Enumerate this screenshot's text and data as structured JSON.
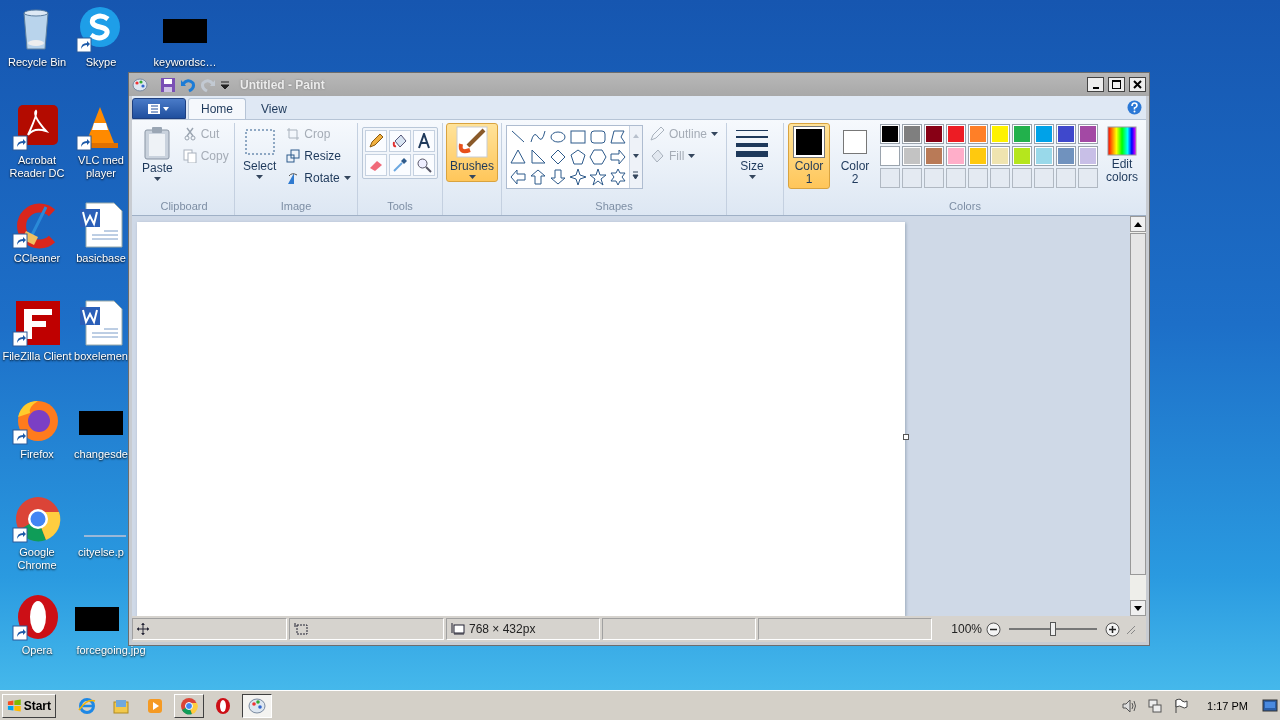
{
  "desktop": {
    "columns": [
      [
        {
          "label": "Recycle Bin",
          "shortcut": false
        },
        {
          "label": "Acrobat\nReader DC",
          "shortcut": true
        },
        {
          "label": "CCleaner",
          "shortcut": true
        },
        {
          "label": "FileZilla Client",
          "shortcut": true
        },
        {
          "label": "Firefox",
          "shortcut": true
        },
        {
          "label": "Google\nChrome",
          "shortcut": true
        },
        {
          "label": "Opera",
          "shortcut": true
        }
      ],
      [
        {
          "label": "Skype",
          "shortcut": true
        },
        {
          "label": "VLC med\nplayer",
          "shortcut": true
        },
        {
          "label": "basicbase",
          "shortcut": false
        },
        {
          "label": "boxelemen",
          "shortcut": false
        },
        {
          "label": "changesde",
          "shortcut": false
        },
        {
          "label": "cityelse.p",
          "shortcut": false
        },
        {
          "label": "forcegoing.jpg",
          "shortcut": false
        }
      ],
      [
        {
          "label": "keywordsc…",
          "shortcut": false
        }
      ]
    ]
  },
  "paint": {
    "title": "Untitled - Paint",
    "tabs": [
      {
        "label": "Home",
        "selected": true
      },
      {
        "label": "View",
        "selected": false
      }
    ],
    "ribbon": {
      "clipboard": {
        "label": "Clipboard",
        "paste": "Paste",
        "cut": {
          "label": "Cut",
          "disabled": true
        },
        "copy": {
          "label": "Copy",
          "disabled": true
        }
      },
      "image": {
        "label": "Image",
        "select": "Select",
        "crop": {
          "label": "Crop",
          "disabled": true
        },
        "resize": {
          "label": "Resize",
          "disabled": false
        },
        "rotate": {
          "label": "Rotate",
          "disabled": false
        }
      },
      "tools": {
        "label": "Tools"
      },
      "brushes": {
        "label": "Brushes",
        "selected": true
      },
      "shapes": {
        "label": "Shapes",
        "outline": {
          "label": "Outline",
          "disabled": true
        },
        "fill": {
          "label": "Fill",
          "disabled": true
        }
      },
      "size": {
        "label": "Size"
      },
      "colors": {
        "label": "Colors",
        "color1": {
          "label": "Color\n1",
          "color": "#000000",
          "selected": true
        },
        "color2": {
          "label": "Color\n2",
          "color": "#ffffff",
          "selected": false
        },
        "palette": [
          {
            "color": "#000000"
          },
          {
            "color": "#7f7f7f"
          },
          {
            "color": "#880015"
          },
          {
            "color": "#ed1c24"
          },
          {
            "color": "#ff7f27"
          },
          {
            "color": "#fff200"
          },
          {
            "color": "#22b14c"
          },
          {
            "color": "#00a2e8"
          },
          {
            "color": "#3f48cc"
          },
          {
            "color": "#a349a4"
          },
          {
            "color": "#ffffff"
          },
          {
            "color": "#c3c3c3"
          },
          {
            "color": "#b97a57"
          },
          {
            "color": "#ffaec9"
          },
          {
            "color": "#ffc90e"
          },
          {
            "color": "#efe4b0"
          },
          {
            "color": "#b5e61d"
          },
          {
            "color": "#99d9ea"
          },
          {
            "color": "#7092be"
          },
          {
            "color": "#c8bfe7"
          }
        ],
        "edit": "Edit\ncolors"
      }
    },
    "status": {
      "dimensions": "768 × 432px",
      "zoom": "100%",
      "level": 0.5
    }
  },
  "taskbar": {
    "start": "Start",
    "apps": [
      {
        "running": false,
        "active": false
      },
      {
        "running": false,
        "active": false
      },
      {
        "running": false,
        "active": false
      },
      {
        "running": true,
        "active": false
      },
      {
        "running": false,
        "active": false
      },
      {
        "running": true,
        "active": true
      }
    ],
    "clock": "1:17 PM"
  }
}
